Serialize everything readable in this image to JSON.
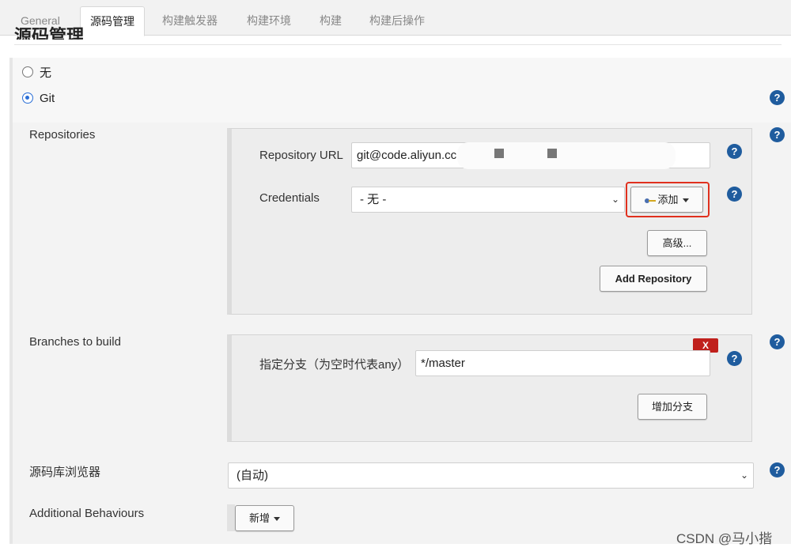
{
  "tabs": [
    {
      "label": "General"
    },
    {
      "label": "源码管理"
    },
    {
      "label": "构建触发器"
    },
    {
      "label": "构建环境"
    },
    {
      "label": "构建"
    },
    {
      "label": "构建后操作"
    }
  ],
  "section_title": "源码管理",
  "scm_options": {
    "none_label": "无",
    "git_label": "Git",
    "selected": "Git"
  },
  "repositories": {
    "label": "Repositories",
    "url_label": "Repository URL",
    "url_value": "git@code.aliyun.cc",
    "credentials_label": "Credentials",
    "credentials_value": "- 无 -",
    "add_button": "添加",
    "advanced_button": "高级...",
    "add_repository_button": "Add Repository"
  },
  "branches": {
    "label": "Branches to build",
    "branch_spec_label": "指定分支（为空时代表any）",
    "branch_spec_value": "*/master",
    "delete_button": "X",
    "add_branch_button": "增加分支"
  },
  "repo_browser": {
    "label": "源码库浏览器",
    "value": "(自动)"
  },
  "additional_behaviours": {
    "label": "Additional Behaviours",
    "add_button": "新增"
  },
  "help_glyph": "?",
  "watermark": "CSDN @马小揩",
  "colors": {
    "help_icon": "#1f5c9e",
    "highlight_box": "#e0301e",
    "delete_button": "#c0201c",
    "radio_selected": "#2a6ed6"
  }
}
